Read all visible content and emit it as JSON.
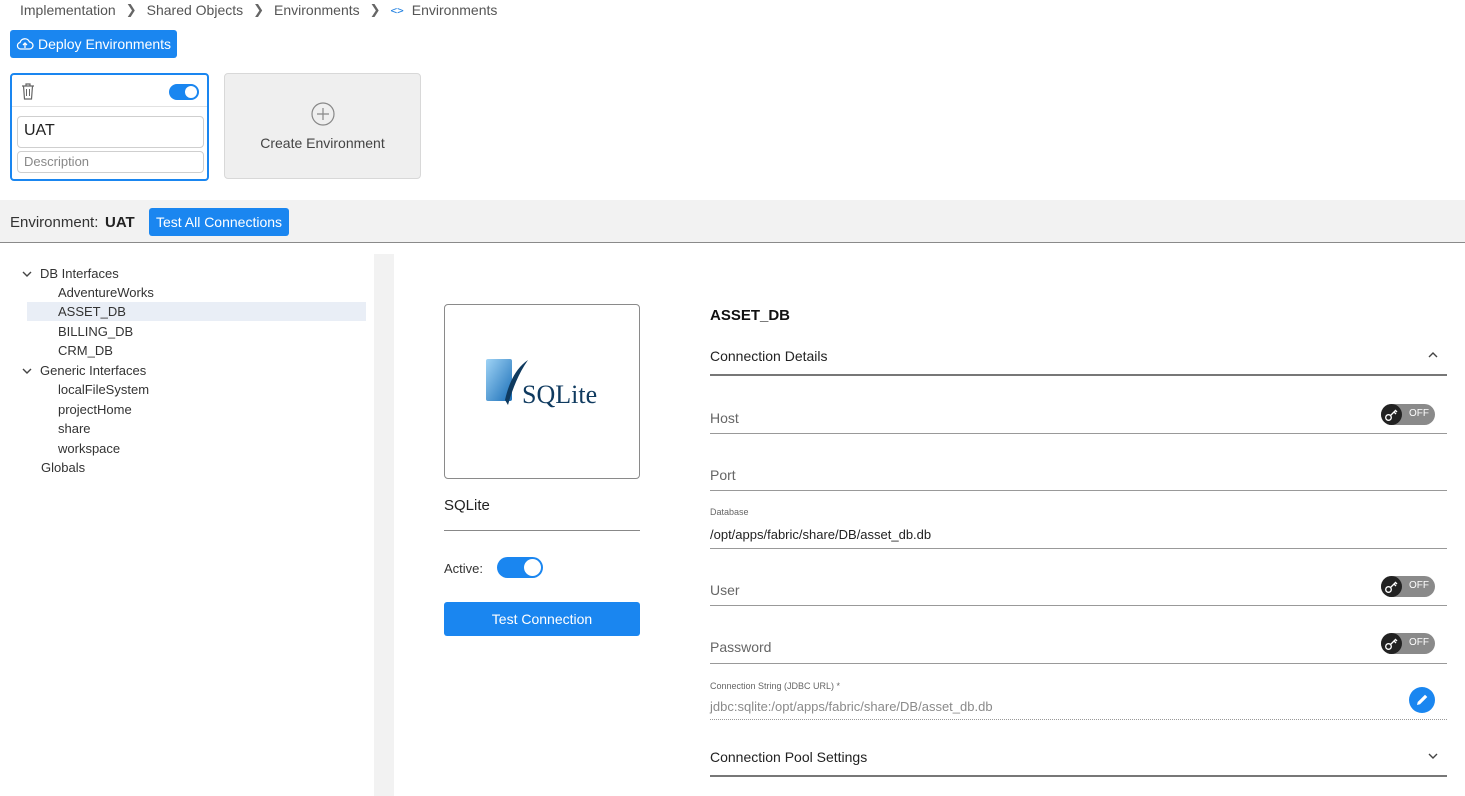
{
  "breadcrumb": [
    "Implementation",
    "Shared Objects",
    "Environments",
    "Environments"
  ],
  "deploy_label": "Deploy Environments",
  "env_card": {
    "name": "UAT",
    "description_placeholder": "Description",
    "active": true
  },
  "create_label": "Create Environment",
  "env_bar": {
    "label": "Environment:",
    "value": "UAT",
    "test_all_label": "Test All Connections"
  },
  "tree": {
    "groups": [
      {
        "label": "DB Interfaces",
        "items": [
          "AdventureWorks",
          "ASSET_DB",
          "BILLING_DB",
          "CRM_DB"
        ]
      },
      {
        "label": "Generic Interfaces",
        "items": [
          "localFileSystem",
          "projectHome",
          "share",
          "workspace"
        ]
      }
    ],
    "globals": "Globals",
    "selected": "ASSET_DB"
  },
  "detail": {
    "logo_text": "SQLite",
    "db_type": "SQLite",
    "active_label": "Active:",
    "test_label": "Test Connection",
    "title": "ASSET_DB",
    "connection_details": "Connection Details",
    "host_label": "Host",
    "port_label": "Port",
    "database_label": "Database",
    "database_value": "/opt/apps/fabric/share/DB/asset_db.db",
    "user_label": "User",
    "password_label": "Password",
    "off_label": "OFF",
    "conn_string_label": "Connection String (JDBC URL) *",
    "conn_string_value": "jdbc:sqlite:/opt/apps/fabric/share/DB/asset_db.db",
    "pool_label": "Connection Pool Settings"
  },
  "colors": {
    "accent": "#1a86f0"
  }
}
